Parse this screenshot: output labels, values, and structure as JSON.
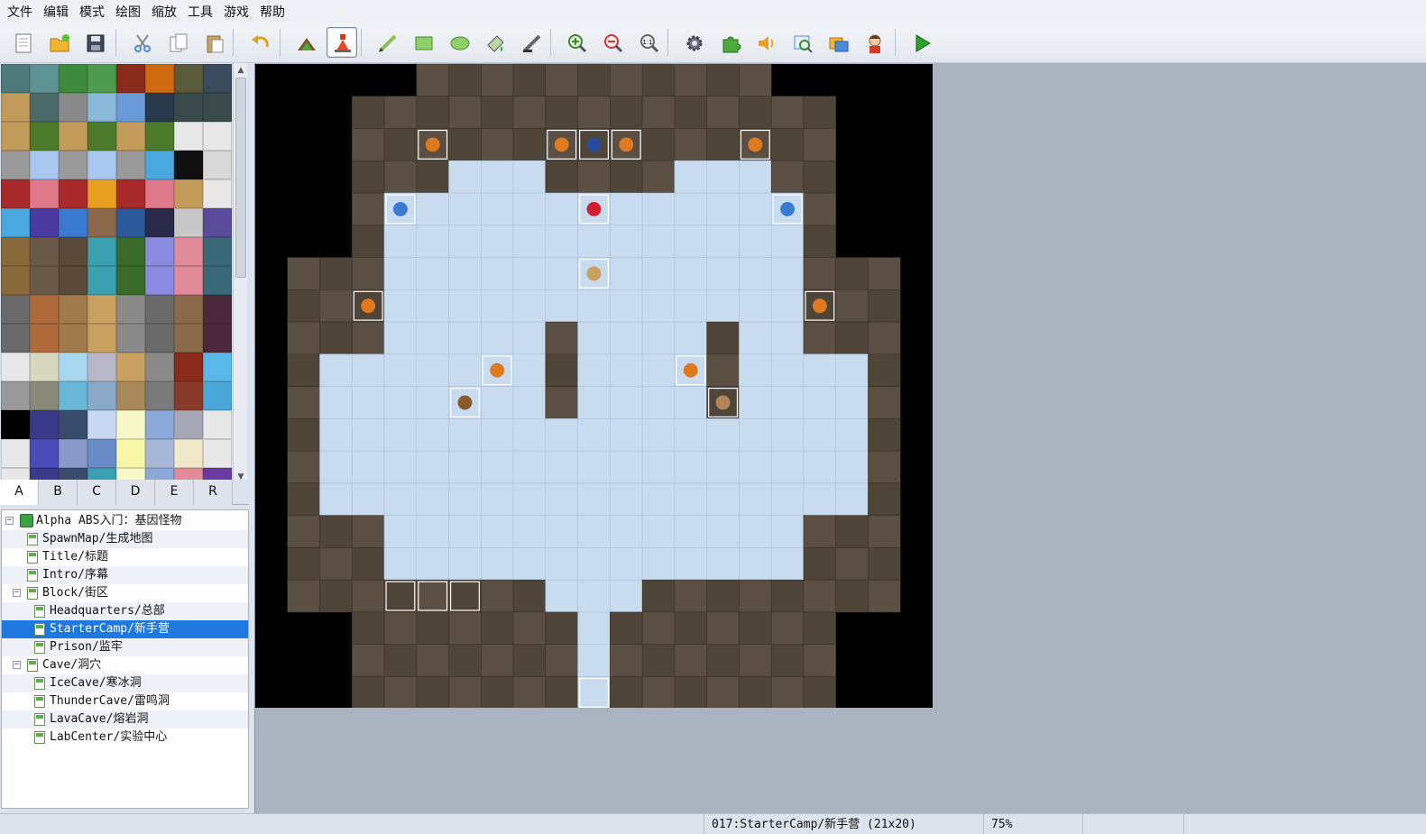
{
  "menu": [
    "文件",
    "编辑",
    "模式",
    "绘图",
    "缩放",
    "工具",
    "游戏",
    "帮助"
  ],
  "toolbar": {
    "buttons": [
      {
        "name": "new-project-icon"
      },
      {
        "name": "open-project-icon"
      },
      {
        "name": "save-project-icon"
      },
      {
        "name": "cut-icon"
      },
      {
        "name": "copy-icon"
      },
      {
        "name": "paste-icon"
      },
      {
        "name": "undo-icon"
      },
      {
        "name": "map-layer-icon"
      },
      {
        "name": "event-layer-icon",
        "active": true
      },
      {
        "name": "pencil-icon"
      },
      {
        "name": "rectangle-icon"
      },
      {
        "name": "ellipse-icon"
      },
      {
        "name": "fill-icon"
      },
      {
        "name": "shadow-pen-icon"
      },
      {
        "name": "zoom-in-icon"
      },
      {
        "name": "zoom-out-icon"
      },
      {
        "name": "zoom-actual-icon"
      },
      {
        "name": "database-icon"
      },
      {
        "name": "plugin-icon"
      },
      {
        "name": "sound-test-icon"
      },
      {
        "name": "event-search-icon"
      },
      {
        "name": "resource-manager-icon"
      },
      {
        "name": "character-generator-icon"
      },
      {
        "name": "playtest-icon"
      }
    ]
  },
  "tile_tabs": [
    "A",
    "B",
    "C",
    "D",
    "E",
    "R"
  ],
  "tile_tab_active": "A",
  "map_tree": [
    {
      "label": "Alpha ABS入门：基因怪物",
      "level": 0,
      "toggle": "−",
      "root": true
    },
    {
      "label": "SpawnMap/生成地图",
      "level": 1
    },
    {
      "label": "Title/标题",
      "level": 1
    },
    {
      "label": "Intro/序幕",
      "level": 1
    },
    {
      "label": "Block/街区",
      "level": 1,
      "toggle": "−"
    },
    {
      "label": "Headquarters/总部",
      "level": 2
    },
    {
      "label": "StarterCamp/新手营",
      "level": 2,
      "selected": true
    },
    {
      "label": "Prison/监牢",
      "level": 2
    },
    {
      "label": "Cave/洞穴",
      "level": 1,
      "toggle": "−"
    },
    {
      "label": "IceCave/寒冰洞",
      "level": 2
    },
    {
      "label": "ThunderCave/雷鸣洞",
      "level": 2
    },
    {
      "label": "LavaCave/熔岩洞",
      "level": 2
    },
    {
      "label": "LabCenter/实验中心",
      "level": 2
    }
  ],
  "status": {
    "map_info": "017:StarterCamp/新手营 (21x20)",
    "zoom": "75%"
  },
  "colors": {
    "ice_floor": "#c9dcef",
    "rock_wall": "#5a4f42",
    "void": "#000000",
    "selection": "#1e78e0"
  }
}
